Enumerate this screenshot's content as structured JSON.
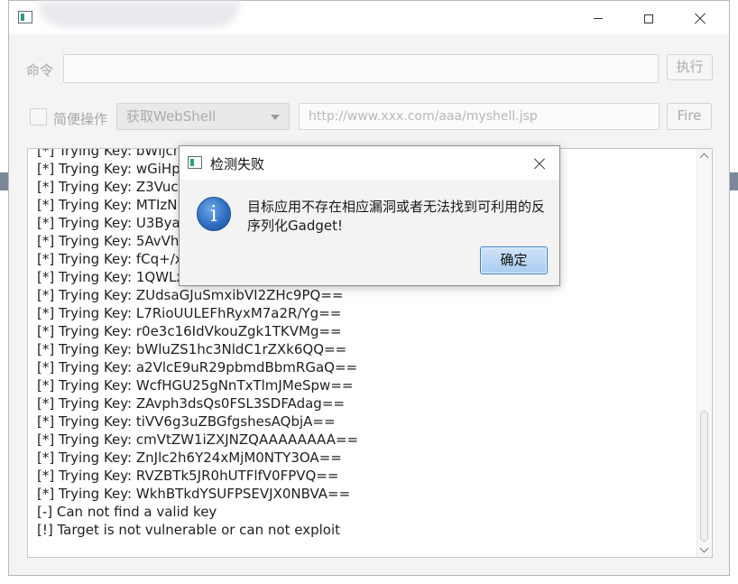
{
  "window": {
    "title": ""
  },
  "command": {
    "label": "命令",
    "value": "",
    "execute_label": "执行"
  },
  "quick": {
    "checkbox_label": "简便操作",
    "combo_value": "获取WebShell",
    "url_placeholder": "http://www.xxx.com/aaa/myshell.jsp",
    "fire_label": "Fire"
  },
  "output": {
    "lines": [
      "[*] Trying Key: bWljcmv",
      "[*] Trying Key: wGiHplam",
      "[*] Trying Key: Z3Vucw",
      "[*] Trying Key: MTIzND",
      "[*] Trying Key: U3ByaW",
      "[*] Trying Key: 5AvVhm",
      "[*] Trying Key: fCq+/xV",
      "[*] Trying Key: 1QWLxg",
      "[*] Trying Key: ZUdsaGJuSmxibVI2ZHc9PQ==",
      "[*] Trying Key: L7RioUULEFhRyxM7a2R/Yg==",
      "[*] Trying Key: r0e3c16IdVkouZgk1TKVMg==",
      "[*] Trying Key: bWluZS1hc3NldC1rZXk6QQ==",
      "[*] Trying Key: a2VlcE9uR29pbmdBbmRGaQ==",
      "[*] Trying Key: WcfHGU25gNnTxTlmJMeSpw==",
      "[*] Trying Key: ZAvph3dsQs0FSL3SDFAdag==",
      "[*] Trying Key: tiVV6g3uZBGfgshesAQbjA==",
      "[*] Trying Key: cmVtZW1iZXJNZQAAAAAAAA==",
      "[*] Trying Key: ZnJlc2h6Y24xMjM0NTY3OA==",
      "[*] Trying Key: RVZBTk5JR0hUTFlfV0FPVQ==",
      "[*] Trying Key: WkhBTkdYSUFPSEVJX0NBVA==",
      "[-] Can not find a valid key",
      "[!] Target is not vulnerable or can not exploit"
    ]
  },
  "dialog": {
    "title": "检测失败",
    "message": "目标应用不存在相应漏洞或者无法找到可利用的反序列化Gadget!",
    "ok_label": "确定"
  },
  "colors": {
    "accent": "#3c7fc4",
    "dim_text": "#a7a7a7",
    "background_strip": "#7a8899"
  }
}
